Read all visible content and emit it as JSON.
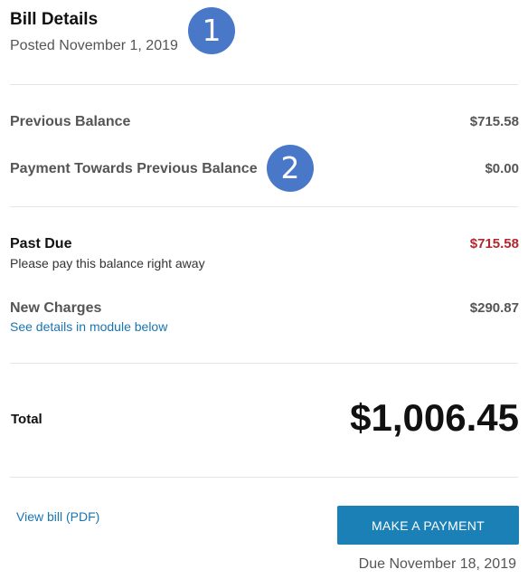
{
  "header": {
    "title": "Bill Details",
    "posted": "Posted November 1, 2019"
  },
  "markers": [
    "1",
    "2"
  ],
  "balances": {
    "previous_balance": {
      "label": "Previous Balance",
      "value": "$715.58"
    },
    "payment_towards": {
      "label": "Payment Towards Previous Balance",
      "value": "$0.00"
    }
  },
  "charges": {
    "past_due": {
      "label": "Past Due",
      "value": "$715.58",
      "note": "Please pay this balance right away"
    },
    "new_charges": {
      "label": "New Charges",
      "value": "$290.87",
      "link": "See details in module below"
    }
  },
  "total": {
    "label": "Total",
    "value": "$1,006.45"
  },
  "footer": {
    "pdf_link": "View bill (PDF)",
    "pay_button": "MAKE A PAYMENT",
    "due_date": "Due November 18, 2019"
  },
  "colors": {
    "marker": "#4a78c8",
    "past_due_value": "#b3272e",
    "link": "#1a75b0",
    "button": "#1a80b6"
  }
}
